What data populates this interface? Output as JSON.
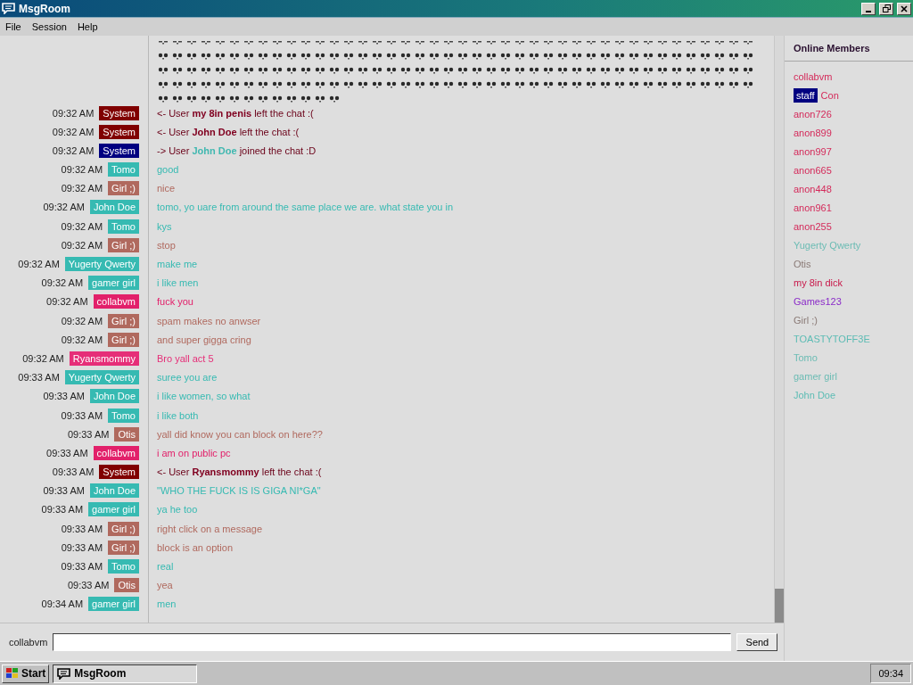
{
  "window": {
    "title": "MsgRoom"
  },
  "menu": [
    "File",
    "Session",
    "Help"
  ],
  "messages": [
    {
      "kind": "skulls"
    },
    {
      "kind": "system",
      "time": "09:32 AM",
      "user": "System",
      "color": "#800000",
      "prefix": "<- User",
      "name": {
        "text": "my 8in penis",
        "color": "#800020"
      },
      "suffix": "left the chat :("
    },
    {
      "kind": "system",
      "time": "09:32 AM",
      "user": "System",
      "color": "#800000",
      "prefix": "<- User",
      "name": {
        "text": "John Doe",
        "color": "#800020"
      },
      "suffix": "left the chat :("
    },
    {
      "kind": "system",
      "time": "09:32 AM",
      "user": "System",
      "color": "#000080",
      "prefix": "-> User",
      "name": {
        "text": "John Doe",
        "color": "#40b8b0"
      },
      "suffix": "joined the chat :D"
    },
    {
      "kind": "chat",
      "time": "09:32 AM",
      "user": "Tomo",
      "color": "#36bab2",
      "text": "good"
    },
    {
      "kind": "chat",
      "time": "09:32 AM",
      "user": "Girl ;)",
      "color": "#b0695e",
      "text": "nice"
    },
    {
      "kind": "chat",
      "time": "09:32 AM",
      "user": "John Doe",
      "color": "#36bab2",
      "text": "tomo, yo uare from around the same place we are. what state you in"
    },
    {
      "kind": "chat",
      "time": "09:32 AM",
      "user": "Tomo",
      "color": "#36bab2",
      "text": "kys"
    },
    {
      "kind": "chat",
      "time": "09:32 AM",
      "user": "Girl ;)",
      "color": "#b0695e",
      "text": "stop"
    },
    {
      "kind": "chat",
      "time": "09:32 AM",
      "user": "Yugerty Qwerty",
      "color": "#36bab2",
      "text": "make me"
    },
    {
      "kind": "chat",
      "time": "09:32 AM",
      "user": "gamer girl",
      "color": "#36bab2",
      "text": "i like men"
    },
    {
      "kind": "chat",
      "time": "09:32 AM",
      "user": "collabvm",
      "color": "#e2206a",
      "text": "fuck you"
    },
    {
      "kind": "chat",
      "time": "09:32 AM",
      "user": "Girl ;)",
      "color": "#b0695e",
      "text": "spam makes no anwser"
    },
    {
      "kind": "chat",
      "time": "09:32 AM",
      "user": "Girl ;)",
      "color": "#b0695e",
      "text": "and super gigga cring"
    },
    {
      "kind": "chat",
      "time": "09:32 AM",
      "user": "Ryansmommy",
      "color": "#e62e78",
      "text": "Bro yall act 5"
    },
    {
      "kind": "chat",
      "time": "09:33 AM",
      "user": "Yugerty Qwerty",
      "color": "#36bab2",
      "text": "suree you are"
    },
    {
      "kind": "chat",
      "time": "09:33 AM",
      "user": "John Doe",
      "color": "#36bab2",
      "text": "i like women, so what"
    },
    {
      "kind": "chat",
      "time": "09:33 AM",
      "user": "Tomo",
      "color": "#36bab2",
      "text": "i like both"
    },
    {
      "kind": "chat",
      "time": "09:33 AM",
      "user": "Otis",
      "color": "#b0695e",
      "text": "yall did know you can block on here??"
    },
    {
      "kind": "chat",
      "time": "09:33 AM",
      "user": "collabvm",
      "color": "#e2206a",
      "text": "i am on public pc"
    },
    {
      "kind": "system",
      "time": "09:33 AM",
      "user": "System",
      "color": "#800000",
      "prefix": "<- User",
      "name": {
        "text": "Ryansmommy",
        "color": "#800020"
      },
      "suffix": "left the chat :("
    },
    {
      "kind": "chat",
      "time": "09:33 AM",
      "user": "John Doe",
      "color": "#36bab2",
      "text": "\"WHO THE FUCK IS IS GIGA NI*GA\""
    },
    {
      "kind": "chat",
      "time": "09:33 AM",
      "user": "gamer girl",
      "color": "#36bab2",
      "text": "ya he too"
    },
    {
      "kind": "chat",
      "time": "09:33 AM",
      "user": "Girl ;)",
      "color": "#b0695e",
      "text": "right click on a message"
    },
    {
      "kind": "chat",
      "time": "09:33 AM",
      "user": "Girl ;)",
      "color": "#b0695e",
      "text": "block is an option"
    },
    {
      "kind": "chat",
      "time": "09:33 AM",
      "user": "Tomo",
      "color": "#36bab2",
      "text": "real"
    },
    {
      "kind": "chat",
      "time": "09:33 AM",
      "user": "Otis",
      "color": "#b0695e",
      "text": "yea"
    },
    {
      "kind": "chat",
      "time": "09:34 AM",
      "user": "gamer girl",
      "color": "#36bab2",
      "text": "men"
    }
  ],
  "members_title": "Online Members",
  "members": [
    {
      "name": "collabvm",
      "color": "#d42a5a"
    },
    {
      "name": "Con",
      "color": "#d42a5a",
      "badge": "staff"
    },
    {
      "name": "anon726",
      "color": "#d42a5a"
    },
    {
      "name": "anon899",
      "color": "#d42a5a"
    },
    {
      "name": "anon997",
      "color": "#d42a5a"
    },
    {
      "name": "anon665",
      "color": "#d42a5a"
    },
    {
      "name": "anon448",
      "color": "#d42a5a"
    },
    {
      "name": "anon961",
      "color": "#d42a5a"
    },
    {
      "name": "anon255",
      "color": "#d42a5a"
    },
    {
      "name": "Yugerty Qwerty",
      "color": "#6cbcb4"
    },
    {
      "name": "Otis",
      "color": "#8a7a76"
    },
    {
      "name": "my 8in dick",
      "color": "#c8184a"
    },
    {
      "name": "Games123",
      "color": "#8a2ac8"
    },
    {
      "name": "Girl ;)",
      "color": "#8a7a76"
    },
    {
      "name": "TOASTYTOFF3E",
      "color": "#5cbcb4"
    },
    {
      "name": "Tomo",
      "color": "#6cbcb4"
    },
    {
      "name": "gamer girl",
      "color": "#6cbcb4"
    },
    {
      "name": "John Doe",
      "color": "#5cbcb4"
    }
  ],
  "input": {
    "label": "collabvm",
    "button": "Send"
  },
  "taskbar": {
    "start": "Start",
    "task": "MsgRoom",
    "clock": "09:34"
  }
}
